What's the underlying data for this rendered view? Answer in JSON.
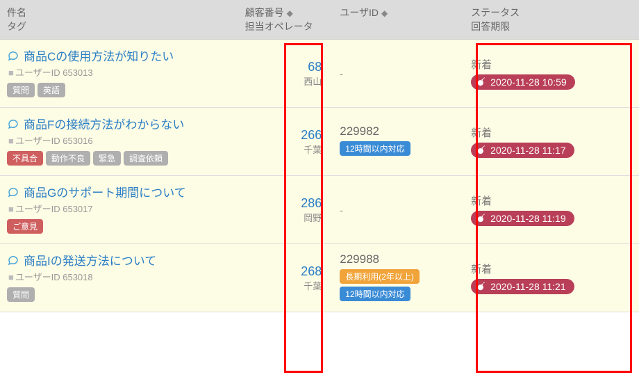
{
  "headers": {
    "title1": "件名",
    "title2": "タグ",
    "customer1": "顧客番号",
    "customer2": "担当オペレータ",
    "user1": "ユーザID",
    "status1": "ステータス",
    "status2": "回答期限"
  },
  "rows": [
    {
      "title": "商品Cの使用方法が知りたい",
      "sub_label": "ユーザーID",
      "sub_value": "653013",
      "tags": [
        {
          "text": "質問",
          "cls": "tag-gray"
        },
        {
          "text": "英語",
          "cls": "tag-gray"
        }
      ],
      "customer_num": "68",
      "operator": "西山",
      "user_id": "",
      "user_dash": "-",
      "user_tags": [],
      "status": "新着",
      "deadline": "2020-11-28 10:59"
    },
    {
      "title": "商品Fの接続方法がわからない",
      "sub_label": "ユーザーID",
      "sub_value": "653016",
      "tags": [
        {
          "text": "不具合",
          "cls": "tag-red"
        },
        {
          "text": "動作不良",
          "cls": "tag-gray"
        },
        {
          "text": "緊急",
          "cls": "tag-gray"
        },
        {
          "text": "調査依頼",
          "cls": "tag-gray"
        }
      ],
      "customer_num": "266",
      "operator": "千葉",
      "user_id": "229982",
      "user_dash": "",
      "user_tags": [
        {
          "text": "12時間以内対応",
          "cls": "tag-blue"
        }
      ],
      "status": "新着",
      "deadline": "2020-11-28 11:17"
    },
    {
      "title": "商品Gのサポート期間について",
      "sub_label": "ユーザーID",
      "sub_value": "653017",
      "tags": [
        {
          "text": "ご意見",
          "cls": "tag-red"
        }
      ],
      "customer_num": "286",
      "operator": "岡野",
      "user_id": "",
      "user_dash": "-",
      "user_tags": [],
      "status": "新着",
      "deadline": "2020-11-28 11:19"
    },
    {
      "title": "商品Iの発送方法について",
      "sub_label": "ユーザーID",
      "sub_value": "653018",
      "tags": [
        {
          "text": "質問",
          "cls": "tag-gray"
        }
      ],
      "customer_num": "268",
      "operator": "千葉",
      "user_id": "229988",
      "user_dash": "",
      "user_tags": [
        {
          "text": "長期利用(2年以上)",
          "cls": "tag-orange"
        },
        {
          "text": "12時間以内対応",
          "cls": "tag-blue"
        }
      ],
      "status": "新着",
      "deadline": "2020-11-28 11:21"
    }
  ]
}
